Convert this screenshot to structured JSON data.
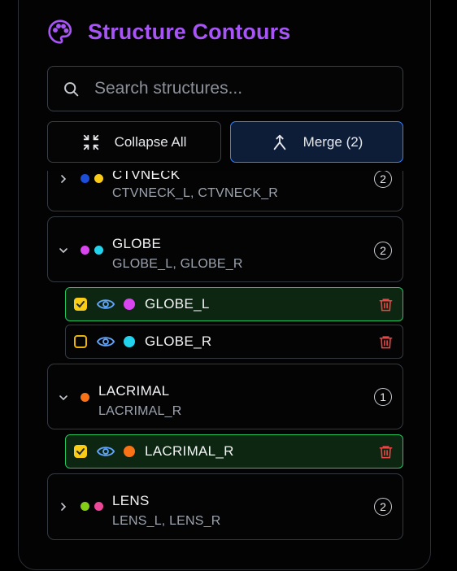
{
  "header": {
    "title": "Structure Contours",
    "icon": "palette-icon",
    "accent": "#a855f7"
  },
  "search": {
    "placeholder": "Search structures..."
  },
  "toolbar": {
    "collapse_label": "Collapse All",
    "merge_label": "Merge (2)"
  },
  "groups": [
    {
      "name": "CTVNECK",
      "members": "CTVNECK_L, CTVNECK_R",
      "count": "2",
      "expanded": false,
      "colors": [
        "#1d4ed8",
        "#facc15"
      ]
    },
    {
      "name": "GLOBE",
      "members": "GLOBE_L, GLOBE_R",
      "count": "2",
      "expanded": true,
      "colors": [
        "#d946ef",
        "#22d3ee"
      ],
      "items": [
        {
          "name": "GLOBE_L",
          "selected": true,
          "color": "#d946ef"
        },
        {
          "name": "GLOBE_R",
          "selected": false,
          "color": "#22d3ee"
        }
      ]
    },
    {
      "name": "LACRIMAL",
      "members": "LACRIMAL_R",
      "count": "1",
      "expanded": true,
      "colors": [
        "#f97316"
      ],
      "items": [
        {
          "name": "LACRIMAL_R",
          "selected": true,
          "color": "#f97316"
        }
      ]
    },
    {
      "name": "LENS",
      "members": "LENS_L, LENS_R",
      "count": "2",
      "expanded": false,
      "colors": [
        "#84cc16",
        "#ec4899"
      ]
    }
  ],
  "colors": {
    "selected_border": "#22c55e",
    "merge_border": "#3b82f6",
    "delete": "#ef4444",
    "checkbox": "#facc15"
  }
}
